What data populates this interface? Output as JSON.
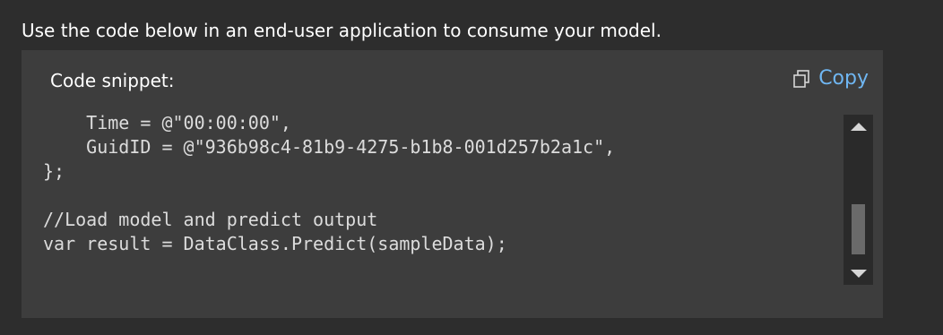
{
  "instruction": "Use the code below in an end-user application to consume your model.",
  "snippet": {
    "title": "Code snippet:",
    "copy_label": "Copy",
    "copy_icon": "copy-icon",
    "copy_color": "#6fb6f2",
    "lines": [
      "    Time = @\"00:00:00\",",
      "    GuidID = @\"936b98c4-81b9-4275-b1b8-001d257b2a1c\",",
      "};",
      "",
      "//Load model and predict output",
      "var result = DataClass.Predict(sampleData);"
    ]
  },
  "scrollbar": {
    "up_icon": "chevron-up-icon",
    "down_icon": "chevron-down-icon"
  }
}
